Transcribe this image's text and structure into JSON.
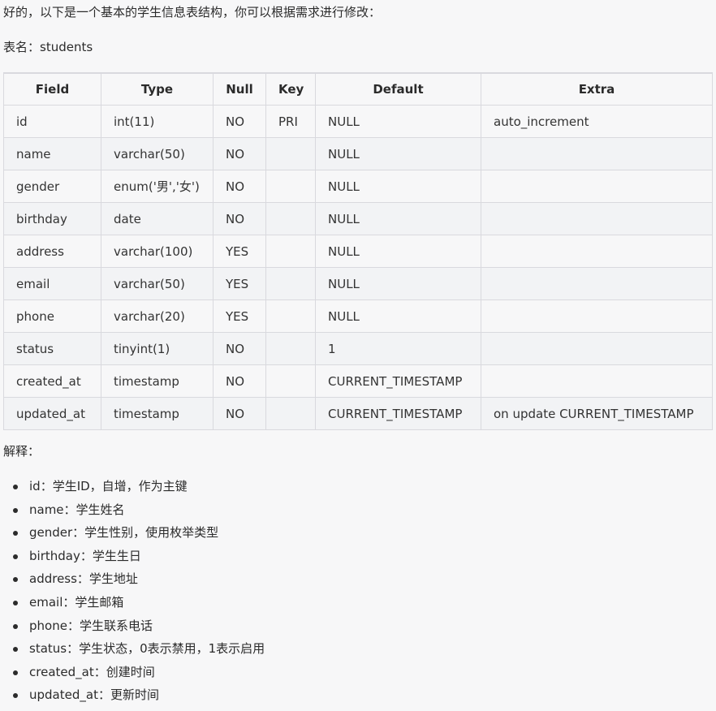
{
  "intro": "好的，以下是一个基本的学生信息表结构，你可以根据需求进行修改：",
  "table_name": "表名：students",
  "table": {
    "headers": [
      "Field",
      "Type",
      "Null",
      "Key",
      "Default",
      "Extra"
    ],
    "rows": [
      [
        "id",
        "int(11)",
        "NO",
        "PRI",
        "NULL",
        "auto_increment"
      ],
      [
        "name",
        "varchar(50)",
        "NO",
        "",
        "NULL",
        ""
      ],
      [
        "gender",
        "enum('男','女')",
        "NO",
        "",
        "NULL",
        ""
      ],
      [
        "birthday",
        "date",
        "NO",
        "",
        "NULL",
        ""
      ],
      [
        "address",
        "varchar(100)",
        "YES",
        "",
        "NULL",
        ""
      ],
      [
        "email",
        "varchar(50)",
        "YES",
        "",
        "NULL",
        ""
      ],
      [
        "phone",
        "varchar(20)",
        "YES",
        "",
        "NULL",
        ""
      ],
      [
        "status",
        "tinyint(1)",
        "NO",
        "",
        "1",
        ""
      ],
      [
        "created_at",
        "timestamp",
        "NO",
        "",
        "CURRENT_TIMESTAMP",
        ""
      ],
      [
        "updated_at",
        "timestamp",
        "NO",
        "",
        "CURRENT_TIMESTAMP",
        "on update CURRENT_TIMESTAMP"
      ]
    ]
  },
  "explain_label": "解释：",
  "explanations": [
    "id：学生ID，自增，作为主键",
    "name：学生姓名",
    "gender：学生性别，使用枚举类型",
    "birthday：学生生日",
    "address：学生地址",
    "email：学生邮箱",
    "phone：学生联系电话",
    "status：学生状态，0表示禁用，1表示启用",
    "created_at：创建时间",
    "updated_at：更新时间"
  ]
}
